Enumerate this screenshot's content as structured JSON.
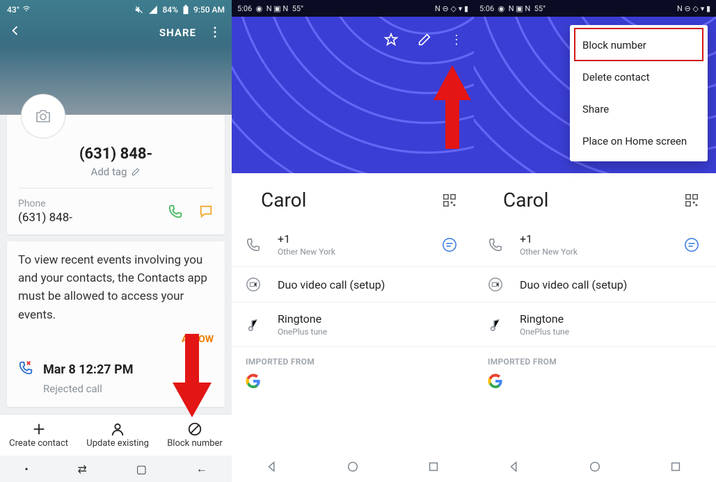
{
  "col1": {
    "status": {
      "temp": "43°",
      "battery": "84%",
      "time": "9:50 AM"
    },
    "share": "SHARE",
    "contact_number": "(631) 848-",
    "add_tag": "Add tag",
    "phone_label": "Phone",
    "phone_value": "(631) 848-",
    "info_text": "To view recent events involving you and your contacts, the Contacts app must be allowed to access your events.",
    "allow": "ALLOW",
    "event_time": "Mar 8 12:27 PM",
    "event_status": "Rejected call",
    "actions": {
      "create": "Create contact",
      "update": "Update existing",
      "block": "Block number"
    }
  },
  "col2": {
    "status": {
      "time": "5:06",
      "temp": "55°"
    },
    "name": "Carol",
    "phone_prefix": "+1",
    "phone_meta": "Other New York",
    "duo": "Duo video call (setup)",
    "ringtone_label": "Ringtone",
    "ringtone_value": "OnePlus tune",
    "imported": "IMPORTED FROM"
  },
  "col3": {
    "status": {
      "time": "5:06",
      "temp": "55°"
    },
    "name": "Carol",
    "phone_prefix": "+1",
    "phone_meta": "Other New York",
    "duo": "Duo video call (setup)",
    "ringtone_label": "Ringtone",
    "ringtone_value": "OnePlus tune",
    "imported": "IMPORTED FROM",
    "menu": {
      "block": "Block number",
      "delete": "Delete contact",
      "share": "Share",
      "home": "Place on Home screen"
    }
  }
}
